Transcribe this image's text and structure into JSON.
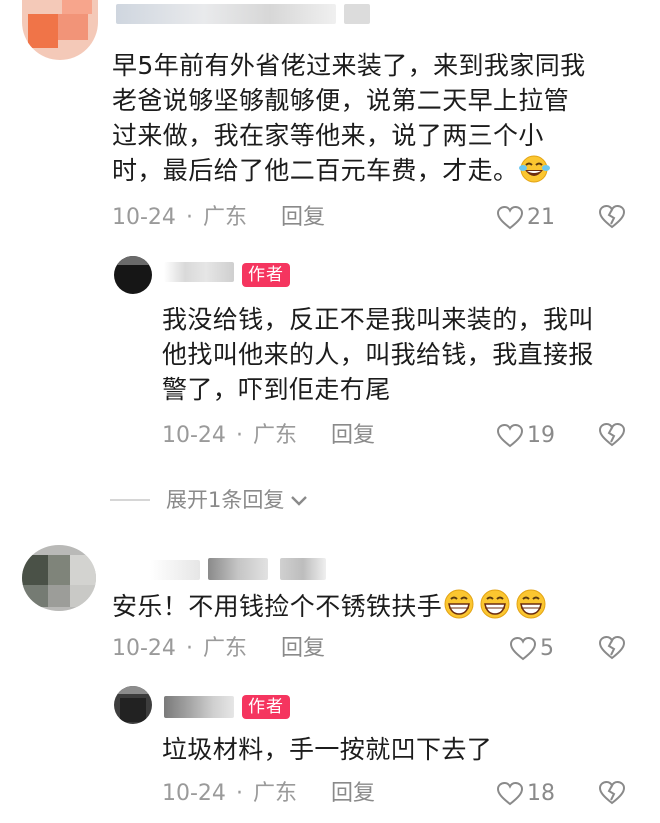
{
  "colors": {
    "author_badge": "#f5355f",
    "meta_text": "#9a9a9a",
    "body_text": "#1c1c1c"
  },
  "comments": [
    {
      "text_lines": [
        "早5年前有外省佬过来装了，来到我家同我",
        "老爸说够坚够靓够便，说第二天早上拉管",
        "过来做，我在家等他来，说了两三个小",
        "时，最后给了他二百元车费，才走。"
      ],
      "emoji": "laughing-tears-emoji",
      "date": "10-24",
      "sep": "·",
      "location": "广东",
      "reply": "回复",
      "likes": "21",
      "replies": [
        {
          "badge": "作者",
          "text_lines": [
            "我没给钱，反正不是我叫来装的，我叫",
            "他找叫他来的人，叫我给钱，我直接报",
            "警了，吓到佢走冇尾"
          ],
          "date": "10-24",
          "sep": "·",
          "location": "广东",
          "reply": "回复",
          "likes": "19"
        }
      ],
      "expand_label": "展开1条回复"
    },
    {
      "text_lines": [
        "安乐！不用钱捡个不锈铁扶手"
      ],
      "emoji": "grinning-emoji",
      "date": "10-24",
      "sep": "·",
      "location": "广东",
      "reply": "回复",
      "likes": "5",
      "replies": [
        {
          "badge": "作者",
          "text_lines": [
            "垃圾材料，手一按就凹下去了"
          ],
          "date": "10-24",
          "sep": "·",
          "location": "广东",
          "reply": "回复",
          "likes": "18"
        }
      ]
    }
  ]
}
